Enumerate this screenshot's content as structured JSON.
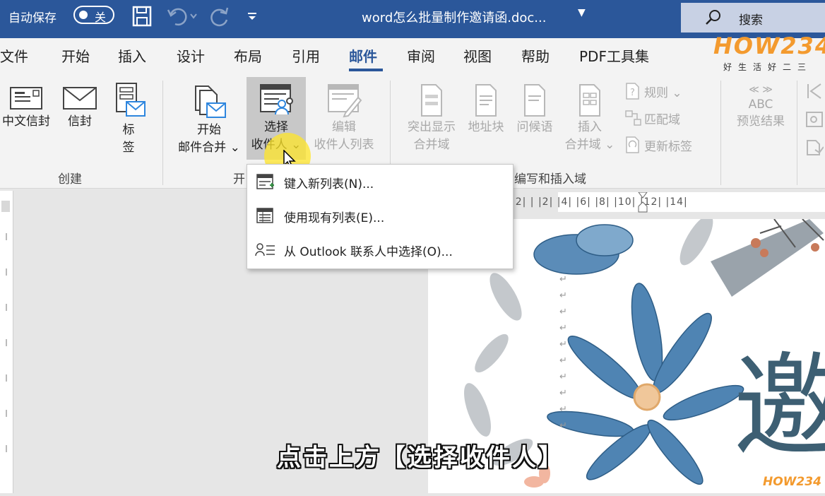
{
  "titlebar": {
    "autosave_label": "自动保存",
    "autosave_state": "关",
    "doc_title": "word怎么批量制作邀请函.doc...",
    "search_label": "搜索",
    "bg_color": "#2b579a"
  },
  "tabs": [
    "文件",
    "开始",
    "插入",
    "设计",
    "布局",
    "引用",
    "邮件",
    "审阅",
    "视图",
    "帮助",
    "PDF工具集"
  ],
  "active_tab": "邮件",
  "brand": {
    "logo": "HOW234",
    "tagline": "好生活好二三"
  },
  "ribbon": {
    "create": {
      "chinese_envelope": "中文信封",
      "envelope": "信封",
      "labels_line1": "标",
      "labels_line2": "签",
      "group_label": "创建"
    },
    "start_merge": {
      "start_line1": "开始",
      "start_line2": "邮件合并 ⌄",
      "select_line1": "选择",
      "select_line2": "收件人 ⌄",
      "edit_line1": "编辑",
      "edit_line2": "收件人列表",
      "group_label": "开"
    },
    "write_insert": {
      "highlight_line1": "突出显示",
      "highlight_line2": "合并域",
      "address_block": "地址块",
      "greeting": "问候语",
      "insert_line1": "插入",
      "insert_line2": "合并域 ⌄",
      "rules": "规则 ⌄",
      "match_fields": "匹配域",
      "update_labels": "更新标签",
      "group_label": "编写和插入域"
    },
    "preview": {
      "abc": "ABC",
      "label": "预览结果"
    }
  },
  "dropdown": {
    "items": [
      {
        "label": "键入新列表(N)...",
        "icon": "new-list-icon"
      },
      {
        "label": "使用现有列表(E)...",
        "icon": "existing-list-icon"
      },
      {
        "label": "从 Outlook 联系人中选择(O)...",
        "icon": "outlook-contacts-icon"
      }
    ]
  },
  "ruler": {
    "labels": "|2|  |  |2|  |4|  |6|  |8|  |10|  |12|  |14|"
  },
  "document": {
    "big_char": "邀"
  },
  "subtitle": "点击上方【选择收件人】",
  "watermark": "HOW234"
}
